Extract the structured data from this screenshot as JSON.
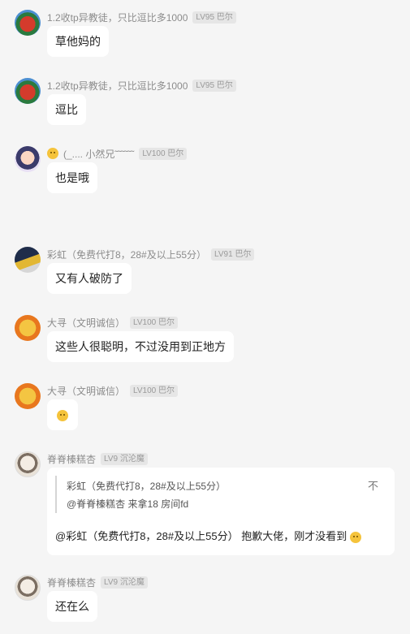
{
  "messages": [
    {
      "id": "m1",
      "name": "1.2收tp异教徒，只比逗比多1000",
      "level": "LV95 巴尔",
      "text": "草他妈的",
      "avatar": "flower-avatar"
    },
    {
      "id": "m2",
      "name": "1.2收tp异教徒，只比逗比多1000",
      "level": "LV95 巴尔",
      "text": "逗比",
      "avatar": "flower-avatar"
    },
    {
      "id": "m3",
      "name": "(_.... 小然兄˜˜˜˜˜˜",
      "level": "LV100 巴尔",
      "text": "也是哦",
      "avatar": "cartoon-avatar"
    },
    {
      "id": "m4",
      "name": "彩虹（免费代打8，28#及以上55分）",
      "level": "LV91 巴尔",
      "text": "又有人破防了",
      "avatar": "rainbow-avatar"
    },
    {
      "id": "m5",
      "name": "大寻（文明诚信）",
      "level": "LV100 巴尔",
      "text": "这些人很聪明，不过没用到正地方",
      "avatar": "orange-avatar"
    },
    {
      "id": "m6",
      "name": "大寻（文明诚信）",
      "level": "LV100 巴尔",
      "text": "",
      "avatar": "orange-avatar"
    },
    {
      "id": "m7",
      "name": "脊脊榛糕杏",
      "level": "LV9 沉沦魔",
      "avatar": "sketch-avatar",
      "quote": {
        "name": "彩虹（免费代打8，28#及以上55分）",
        "text": "@脊脊榛糕杏 来拿18 房间fd",
        "close": "不"
      },
      "text": "@彩虹（免费代打8，28#及以上55分） 抱歉大佬，刚才没看到"
    },
    {
      "id": "m8",
      "name": "脊脊榛糕杏",
      "level": "LV9 沉沦魔",
      "text": "还在么",
      "avatar": "sketch-avatar"
    }
  ]
}
